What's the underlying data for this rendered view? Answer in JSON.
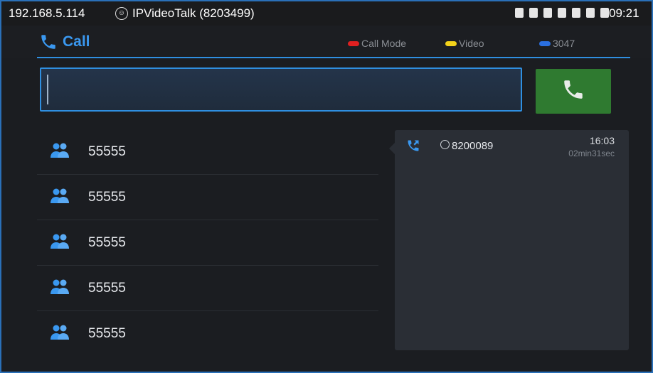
{
  "statusbar": {
    "ip": "192.168.5.114",
    "account": "IPVideoTalk (8203499)",
    "clock": "09:21",
    "icons": [
      "sim-icon",
      "sd-icon",
      "lock-icon",
      "call-icon",
      "bluetooth-icon",
      "battery-icon",
      "network-icon"
    ]
  },
  "header": {
    "title": "Call",
    "legend": [
      {
        "label": "Call Mode",
        "color": "#e02020"
      },
      {
        "label": "Video",
        "color": "#f2d21a"
      },
      {
        "label": "3047",
        "color": "#2a6fe0"
      }
    ]
  },
  "dial": {
    "value": "",
    "button_icon": "phone-icon"
  },
  "contacts": [
    {
      "number": "55555",
      "icon": "group-icon"
    },
    {
      "number": "55555",
      "icon": "group-icon"
    },
    {
      "number": "55555",
      "icon": "group-icon"
    },
    {
      "number": "55555",
      "icon": "group-icon"
    },
    {
      "number": "55555",
      "icon": "group-icon"
    }
  ],
  "call_log": {
    "number": "8200089",
    "time": "16:03",
    "duration": "02min31sec"
  },
  "colors": {
    "accent": "#2f8fe0",
    "call_button": "#2f7a30"
  }
}
